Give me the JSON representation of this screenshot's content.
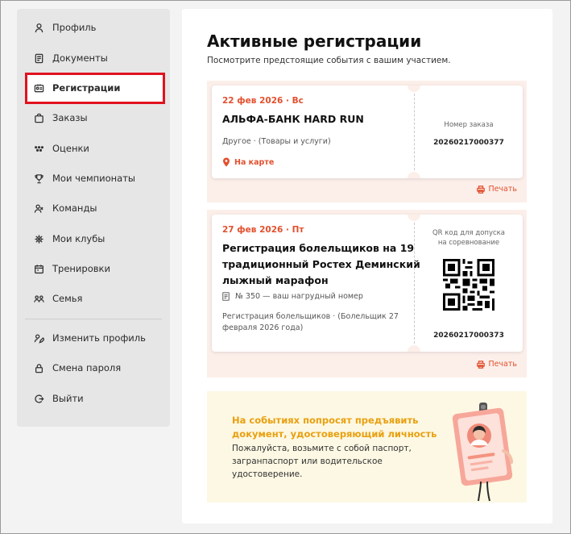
{
  "sidebar": {
    "items": [
      {
        "label": "Профиль",
        "icon": "user-icon"
      },
      {
        "label": "Документы",
        "icon": "document-icon"
      },
      {
        "label": "Регистрации",
        "icon": "id-card-icon",
        "active": true
      },
      {
        "label": "Заказы",
        "icon": "bag-icon"
      },
      {
        "label": "Оценки",
        "icon": "rating-icon"
      },
      {
        "label": "Мои чемпионаты",
        "icon": "trophy-icon"
      },
      {
        "label": "Команды",
        "icon": "team-icon"
      },
      {
        "label": "Мои клубы",
        "icon": "club-icon"
      },
      {
        "label": "Тренировки",
        "icon": "calendar-icon"
      },
      {
        "label": "Семья",
        "icon": "family-icon"
      }
    ],
    "account_items": [
      {
        "label": "Изменить профиль",
        "icon": "edit-profile-icon"
      },
      {
        "label": "Смена пароля",
        "icon": "lock-icon"
      },
      {
        "label": "Выйти",
        "icon": "logout-icon"
      }
    ]
  },
  "main": {
    "title": "Активные регистрации",
    "subtitle": "Посмотрите предстоящие события с вашим участием.",
    "registrations": [
      {
        "date": "22 фев 2026 · Вс",
        "name": "АЛЬФА-БАНК HARD RUN",
        "category": "Другое · (Товары и услуги)",
        "map_label": "На карте",
        "order_label": "Номер заказа",
        "order_number": "20260217000377",
        "print_label": "Печать"
      },
      {
        "date": "27 фев 2026 · Пт",
        "name_lines": [
          "Регистрация болельщиков на 19",
          "традиционный Ростех Деминский",
          "лыжный марафон"
        ],
        "bib": "№ 350 — ваш нагрудный номер",
        "category_lines": [
          "Регистрация болельщиков · (Болельщик 27",
          "февраля 2026 года)"
        ],
        "qr_label_lines": [
          "QR код для допуска",
          "на соревнование"
        ],
        "order_number": "20260217000373",
        "print_label": "Печать"
      }
    ],
    "notice": {
      "title_lines": [
        "На событиях попросят предъявить",
        "документ, удостоверяющий личность"
      ],
      "text_lines": [
        "Пожалуйста, возьмите с собой паспорт,",
        "загранпаспорт или водительское",
        "удостоверение."
      ]
    }
  },
  "colors": {
    "accent": "#e2502e",
    "notice_title": "#e9a010",
    "highlight": "#e0121f"
  }
}
